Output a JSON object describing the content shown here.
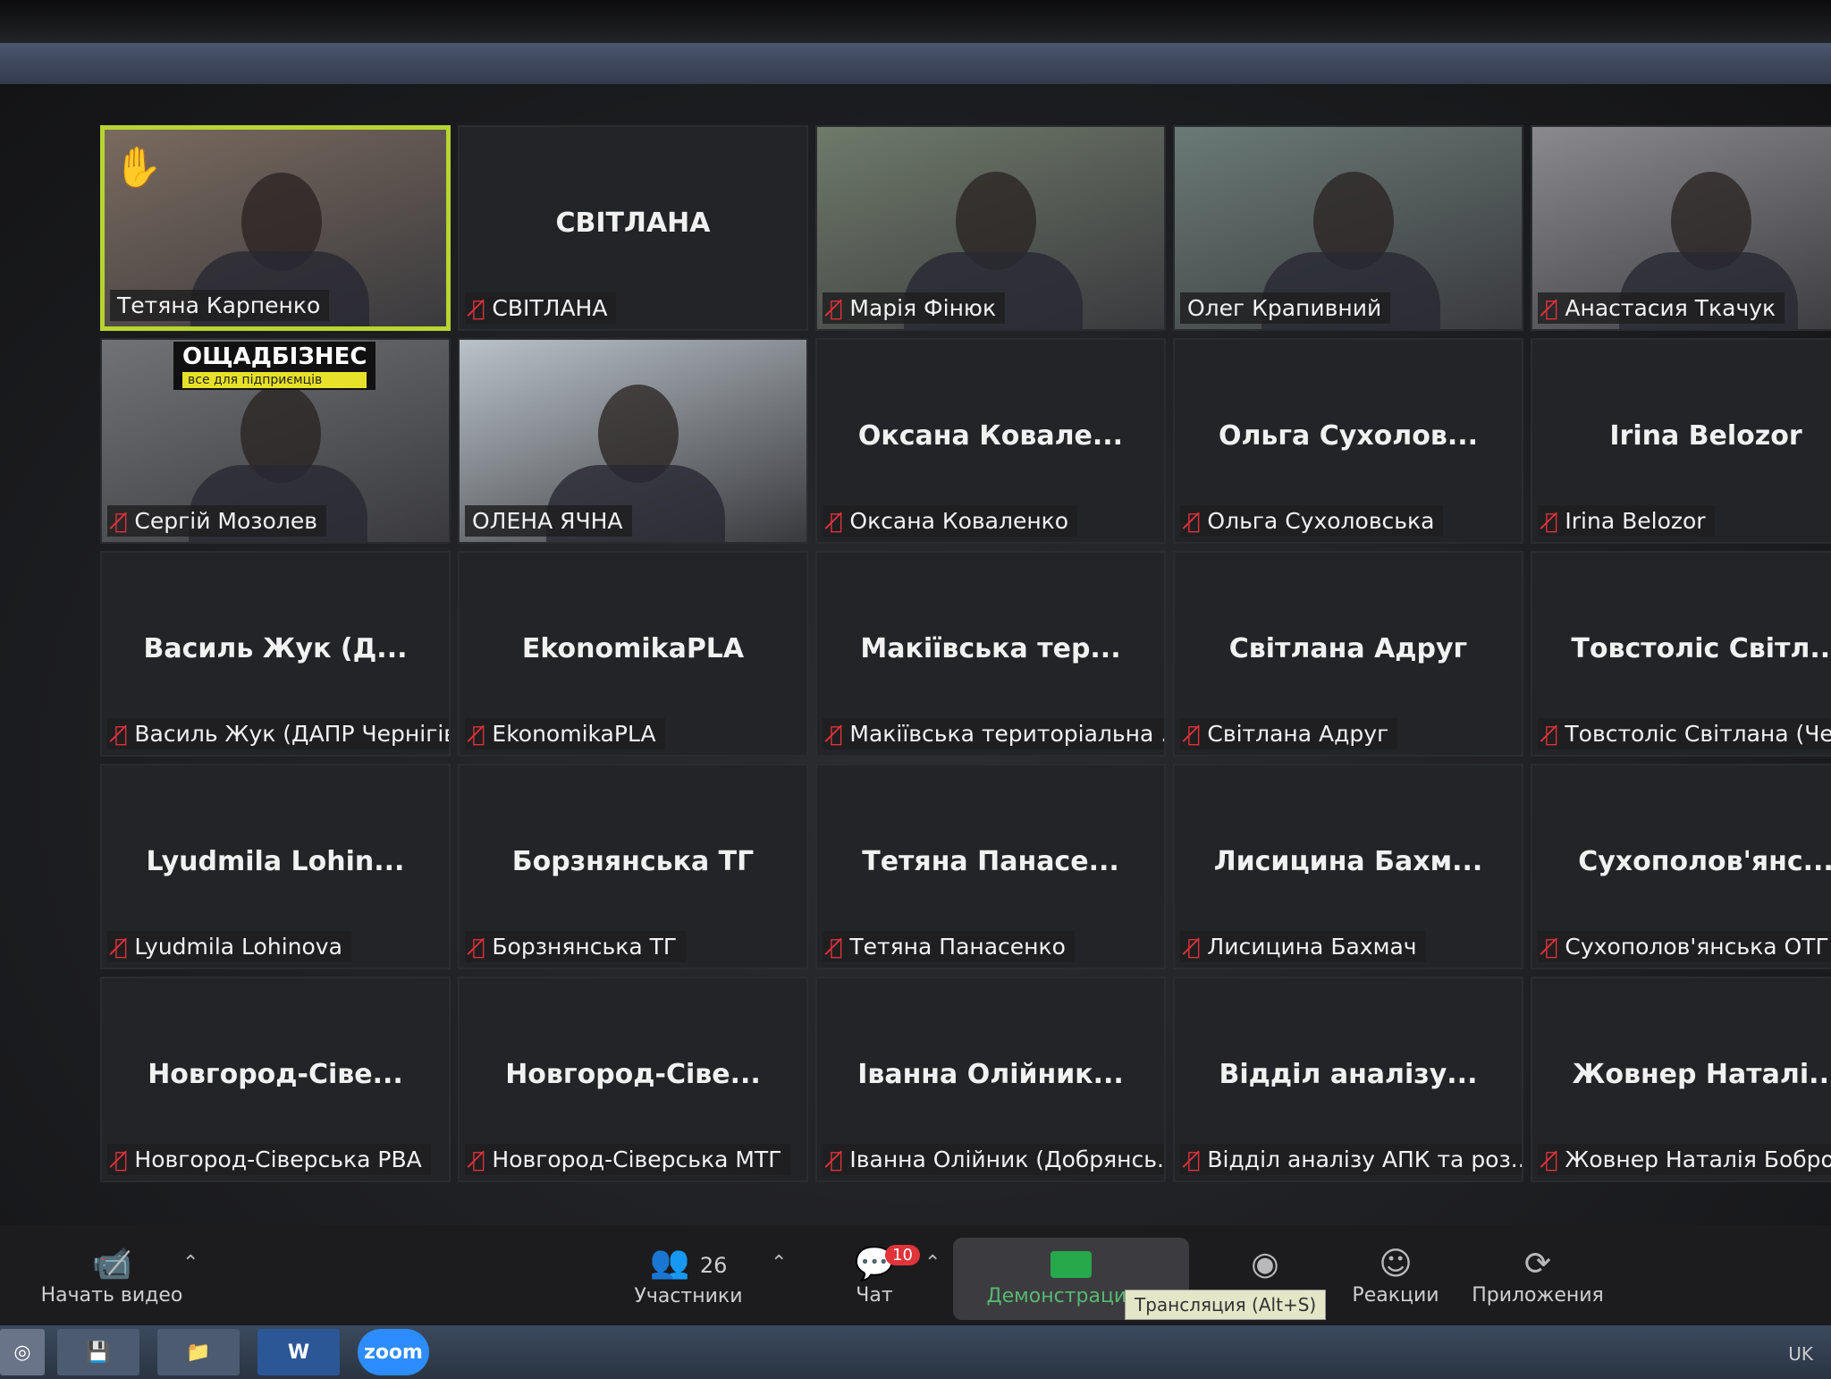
{
  "participants": [
    {
      "id": "p1",
      "label": "Тетяна Карпенко",
      "center": "",
      "video": true,
      "active": true,
      "hand": true,
      "muted": false
    },
    {
      "id": "p2",
      "label": "СВІТЛАНА",
      "center": "СВІТЛАНА",
      "video": false,
      "active": false,
      "hand": false,
      "muted": true
    },
    {
      "id": "p3",
      "label": "Марія Фінюк",
      "center": "",
      "video": true,
      "active": false,
      "hand": false,
      "muted": true
    },
    {
      "id": "p4",
      "label": "Олег Крапивний",
      "center": "",
      "video": true,
      "active": false,
      "hand": false,
      "muted": false
    },
    {
      "id": "p5",
      "label": "Анастасия Ткачук",
      "center": "",
      "video": true,
      "active": false,
      "hand": false,
      "muted": true
    },
    {
      "id": "p6",
      "label": "Сергій Мозолев",
      "center": "",
      "video": true,
      "active": false,
      "hand": false,
      "muted": true,
      "sign": "ОЩАДБІЗНЕС",
      "sign_sub": "все для підприємців"
    },
    {
      "id": "p7",
      "label": "ОЛЕНА ЯЧНА",
      "center": "",
      "video": true,
      "active": false,
      "hand": false,
      "muted": false
    },
    {
      "id": "p8",
      "label": "Оксана Коваленко",
      "center": "Оксана Ковале...",
      "video": false,
      "active": false,
      "hand": false,
      "muted": true
    },
    {
      "id": "p9",
      "label": "Ольга Сухоловська",
      "center": "Ольга Сухолов...",
      "video": false,
      "active": false,
      "hand": false,
      "muted": true
    },
    {
      "id": "p10",
      "label": "Irina Belozor",
      "center": "Irina Belozor",
      "video": false,
      "active": false,
      "hand": false,
      "muted": true
    },
    {
      "id": "p11",
      "label": "Василь Жук (ДАПР Чернігів)",
      "center": "Василь Жук (Д...",
      "video": false,
      "active": false,
      "hand": false,
      "muted": true
    },
    {
      "id": "p12",
      "label": "EkonomikaPLA",
      "center": "EkonomikaPLA",
      "video": false,
      "active": false,
      "hand": false,
      "muted": true
    },
    {
      "id": "p13",
      "label": "Макіївська територіальна ...",
      "center": "Макіївська тер...",
      "video": false,
      "active": false,
      "hand": false,
      "muted": true
    },
    {
      "id": "p14",
      "label": "Світлана Адруг",
      "center": "Світлана Адруг",
      "video": false,
      "active": false,
      "hand": false,
      "muted": true
    },
    {
      "id": "p15",
      "label": "Товстоліс Світлана (Черн",
      "center": "Товстоліс Світл...",
      "video": false,
      "active": false,
      "hand": false,
      "muted": true
    },
    {
      "id": "p16",
      "label": "Lyudmila Lohinova",
      "center": "Lyudmila Lohin...",
      "video": false,
      "active": false,
      "hand": false,
      "muted": true
    },
    {
      "id": "p17",
      "label": "Борзнянська ТГ",
      "center": "Борзнянська ТГ",
      "video": false,
      "active": false,
      "hand": false,
      "muted": true
    },
    {
      "id": "p18",
      "label": "Тетяна Панасенко",
      "center": "Тетяна Панасе...",
      "video": false,
      "active": false,
      "hand": false,
      "muted": true
    },
    {
      "id": "p19",
      "label": "Лисицина Бахмач",
      "center": "Лисицина Бахм...",
      "video": false,
      "active": false,
      "hand": false,
      "muted": true
    },
    {
      "id": "p20",
      "label": "Сухополов'янська ОТГ",
      "center": "Сухополов'янс...",
      "video": false,
      "active": false,
      "hand": false,
      "muted": true
    },
    {
      "id": "p21",
      "label": "Новгород-Сіверська РВА",
      "center": "Новгород-Сіве...",
      "video": false,
      "active": false,
      "hand": false,
      "muted": true
    },
    {
      "id": "p22",
      "label": "Новгород-Сіверська МТГ",
      "center": "Новгород-Сіве...",
      "video": false,
      "active": false,
      "hand": false,
      "muted": true
    },
    {
      "id": "p23",
      "label": "Іванна Олійник (Добрянсь...",
      "center": "Іванна Олійник...",
      "video": false,
      "active": false,
      "hand": false,
      "muted": true
    },
    {
      "id": "p24",
      "label": "Відділ аналізу АПК та роз...",
      "center": "Відділ аналізу...",
      "video": false,
      "active": false,
      "hand": false,
      "muted": true
    },
    {
      "id": "p25",
      "label": "Жовнер Наталія Боброви...",
      "center": "Жовнер Наталі...",
      "video": false,
      "active": false,
      "hand": false,
      "muted": true
    }
  ],
  "toolbar": {
    "start_video": "Начать видео",
    "participants_label": "Участники",
    "participants_count": "26",
    "chat_label": "Чат",
    "chat_badge": "10",
    "share_label": "Демонстрация э",
    "share_tooltip": "Трансляция (Alt+S)",
    "reactions_label": "Реакции",
    "apps_label": "Приложения"
  },
  "taskbar": {
    "word_label": "W",
    "zoom_label": "zoom",
    "lang": "UK"
  },
  "colors": {
    "active_border": "#b8d430",
    "muted_icon": "#e0333a",
    "share_green": "#27a84a"
  }
}
